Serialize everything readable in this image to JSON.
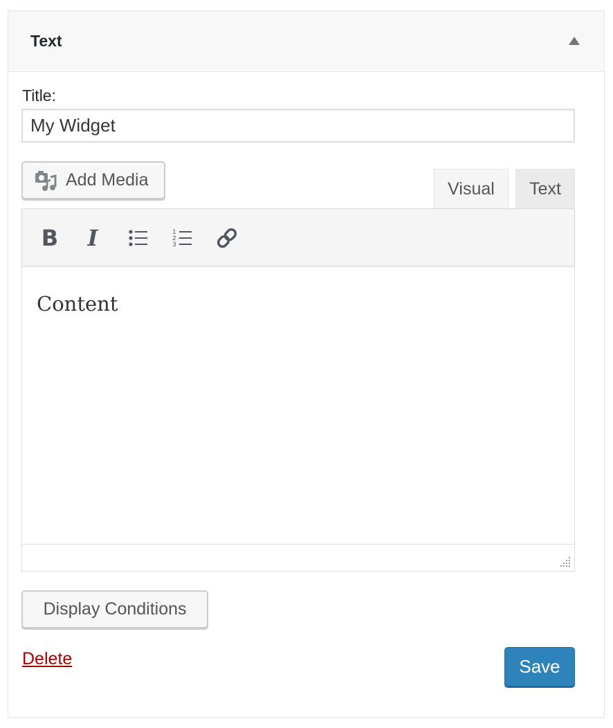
{
  "widget": {
    "title": "Text",
    "toggle_icon": "triangle-up-icon"
  },
  "form": {
    "title_label": "Title:",
    "title_value": "My Widget"
  },
  "media": {
    "add_media_label": "Add Media",
    "icon": "media-icon"
  },
  "editor": {
    "tabs": [
      {
        "label": "Visual",
        "active": true
      },
      {
        "label": "Text",
        "active": false
      }
    ],
    "toolbar": {
      "bold_label": "B",
      "italic_label": "I",
      "icons": [
        "bold-icon",
        "italic-icon",
        "bullet-list-icon",
        "numbered-list-icon",
        "link-icon"
      ]
    },
    "content": "Content"
  },
  "actions": {
    "display_conditions_label": "Display Conditions",
    "delete_label": "Delete",
    "save_label": "Save"
  },
  "colors": {
    "primary": "#2f83bb",
    "delete": "#aa0000",
    "text": "#23282d"
  }
}
